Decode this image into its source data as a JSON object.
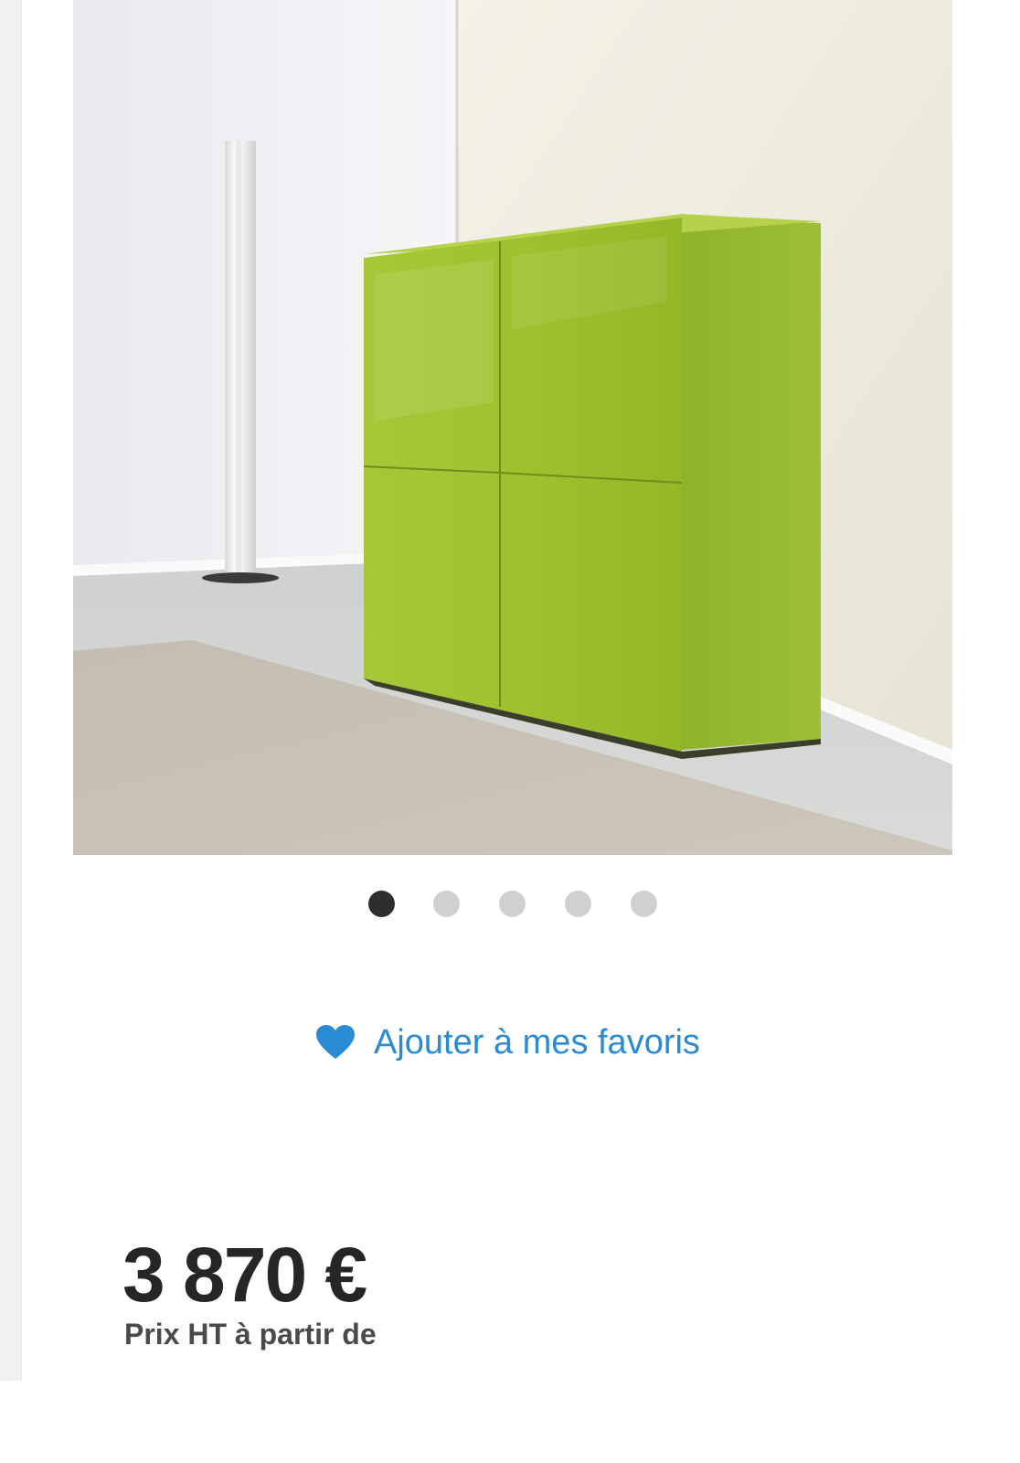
{
  "gallery": {
    "image_icon": "product-photo",
    "slide_count": 5,
    "active_index": 0,
    "colors": {
      "active_dot": "#2e2e30",
      "inactive_dot": "#d0d0d2"
    }
  },
  "favorites": {
    "label": "Ajouter à mes favoris",
    "icon": "heart-icon",
    "color": "#2a8bd3"
  },
  "pricing": {
    "amount": "3 870 €",
    "caption": "Prix HT à partir de"
  }
}
